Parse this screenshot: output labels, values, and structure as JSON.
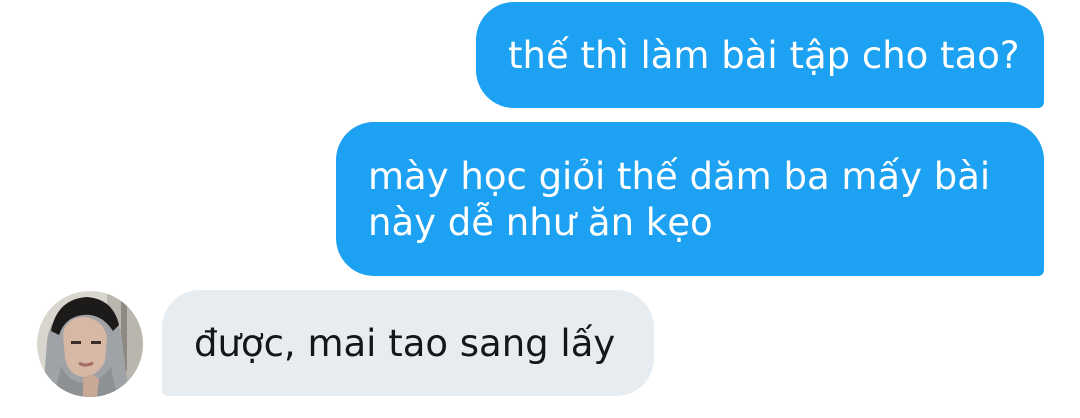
{
  "conversation": {
    "messages": [
      {
        "direction": "outgoing",
        "text": "thế thì làm bài tập cho tao?"
      },
      {
        "direction": "outgoing",
        "text": "mày học giỏi thế dăm ba mấy bài\nnày dễ như ăn kẹo"
      },
      {
        "direction": "incoming",
        "text": "được, mai tao sang lấy"
      }
    ],
    "colors": {
      "outgoing_bubble": "#1da1f2",
      "incoming_bubble": "#e6ecf0",
      "outgoing_text": "#ffffff",
      "incoming_text": "#14171a"
    }
  }
}
